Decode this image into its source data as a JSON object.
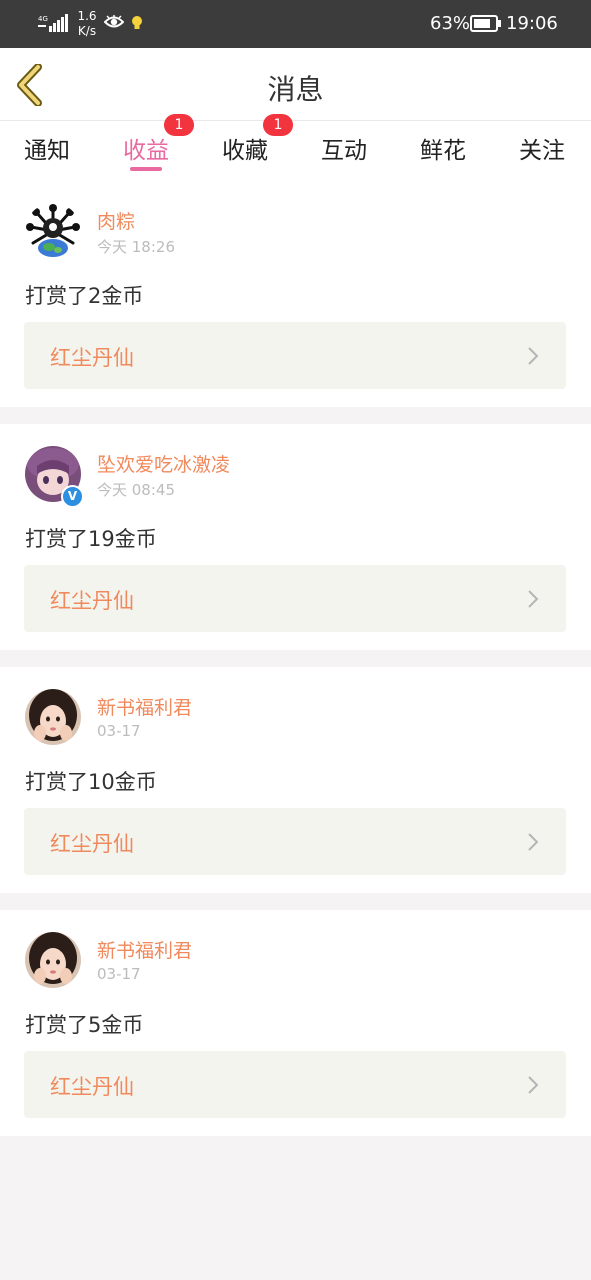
{
  "statusbar": {
    "network_type": "4G",
    "speed_value": "1.6",
    "speed_unit": "K/s",
    "battery": "63%",
    "time": "19:06"
  },
  "header": {
    "title": "消息"
  },
  "tabs": [
    {
      "label": "通知",
      "badge": ""
    },
    {
      "label": "收益",
      "badge": "1",
      "active": true
    },
    {
      "label": "收藏",
      "badge": "1"
    },
    {
      "label": "互动",
      "badge": ""
    },
    {
      "label": "鲜花",
      "badge": ""
    },
    {
      "label": "关注",
      "badge": ""
    }
  ],
  "messages": [
    {
      "user": "肉粽",
      "time": "今天 18:26",
      "text": "打赏了2金币",
      "book": "红尘丹仙",
      "verified": false
    },
    {
      "user": "坠欢爱吃冰激凌",
      "time": "今天 08:45",
      "text": "打赏了19金币",
      "book": "红尘丹仙",
      "verified": true
    },
    {
      "user": "新书福利君",
      "time": "03-17",
      "text": "打赏了10金币",
      "book": "红尘丹仙",
      "verified": false
    },
    {
      "user": "新书福利君",
      "time": "03-17",
      "text": "打赏了5金币",
      "book": "红尘丹仙",
      "verified": false
    }
  ],
  "colors": {
    "accent": "#e86aa0",
    "username": "#f08a5d",
    "badge": "#f2343f",
    "statusbar": "#3c3c3c"
  }
}
